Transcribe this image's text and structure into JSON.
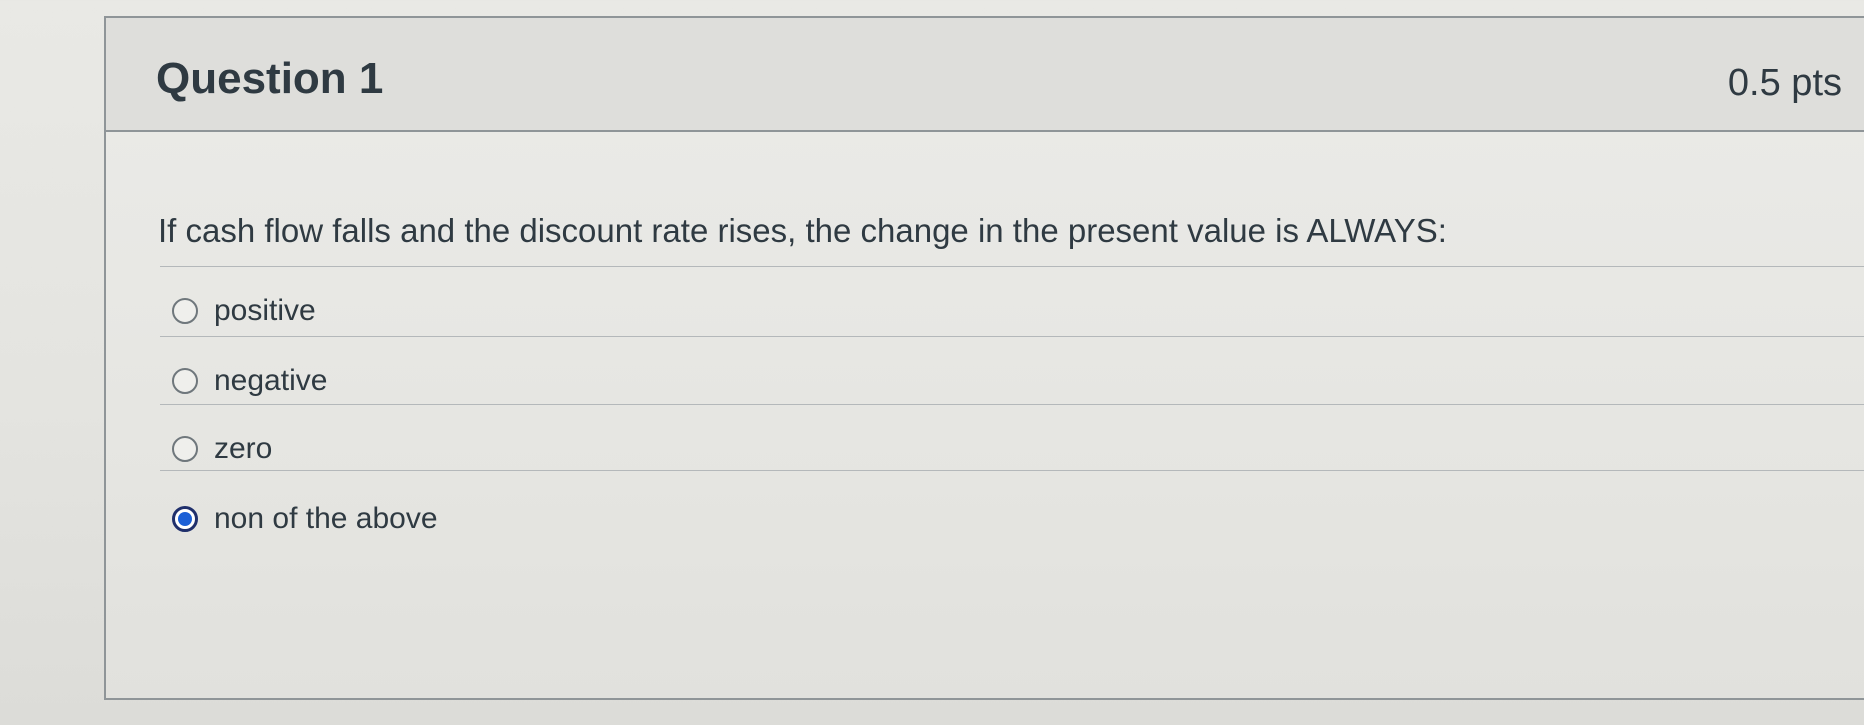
{
  "question": {
    "title": "Question 1",
    "points": "0.5 pts",
    "text": "If cash flow falls and the discount rate rises, the change in the present value is ALWAYS:"
  },
  "answers": [
    {
      "label": "positive",
      "selected": false
    },
    {
      "label": "negative",
      "selected": false
    },
    {
      "label": "zero",
      "selected": false
    },
    {
      "label": "non of the above",
      "selected": true
    }
  ],
  "colors": {
    "selected_radio": "#1b5fd6",
    "text": "#2f3a42"
  }
}
